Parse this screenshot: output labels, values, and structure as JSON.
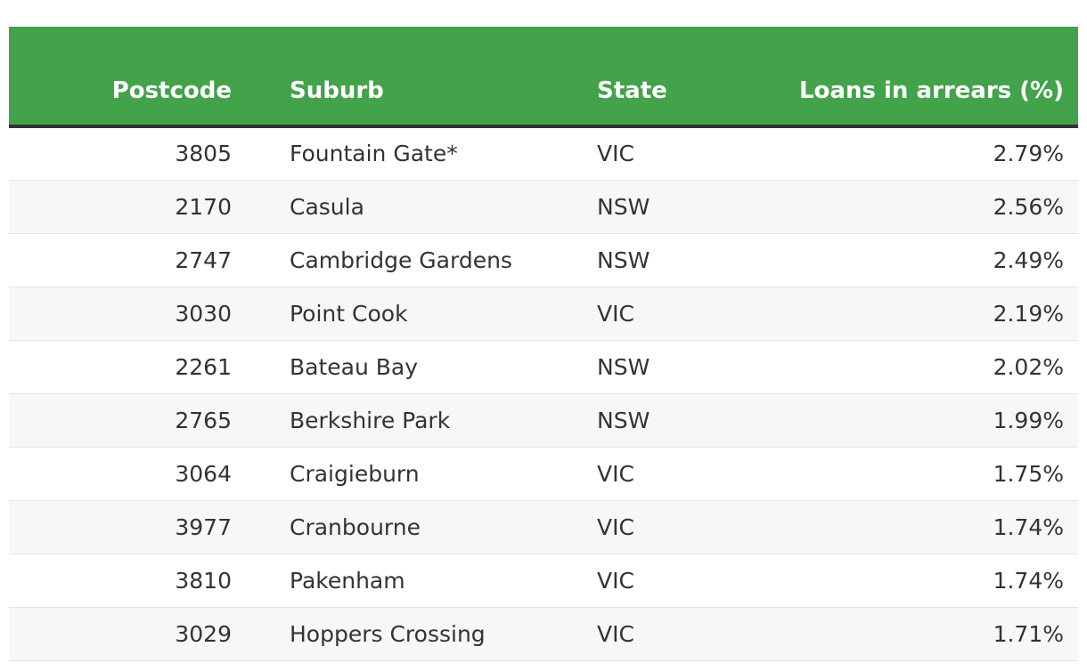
{
  "table": {
    "headers": {
      "postcode": "Postcode",
      "suburb": "Suburb",
      "state": "State",
      "loans": "Loans in arrears (%)"
    },
    "rows": [
      {
        "postcode": "3805",
        "suburb": "Fountain Gate*",
        "state": "VIC",
        "loans": "2.79%"
      },
      {
        "postcode": "2170",
        "suburb": "Casula",
        "state": "NSW",
        "loans": "2.56%"
      },
      {
        "postcode": "2747",
        "suburb": "Cambridge Gardens",
        "state": "NSW",
        "loans": "2.49%"
      },
      {
        "postcode": "3030",
        "suburb": "Point Cook",
        "state": "VIC",
        "loans": "2.19%"
      },
      {
        "postcode": "2261",
        "suburb": "Bateau Bay",
        "state": "NSW",
        "loans": "2.02%"
      },
      {
        "postcode": "2765",
        "suburb": "Berkshire Park",
        "state": "NSW",
        "loans": "1.99%"
      },
      {
        "postcode": "3064",
        "suburb": "Craigieburn",
        "state": "VIC",
        "loans": "1.75%"
      },
      {
        "postcode": "3977",
        "suburb": "Cranbourne",
        "state": "VIC",
        "loans": "1.74%"
      },
      {
        "postcode": "3810",
        "suburb": "Pakenham",
        "state": "VIC",
        "loans": "1.74%"
      },
      {
        "postcode": "3029",
        "suburb": "Hoppers Crossing",
        "state": "VIC",
        "loans": "1.71%"
      }
    ]
  },
  "colors": {
    "header_bg": "#43a34a",
    "header_text": "#ffffff",
    "row_alt_bg": "#f7f7f7"
  }
}
